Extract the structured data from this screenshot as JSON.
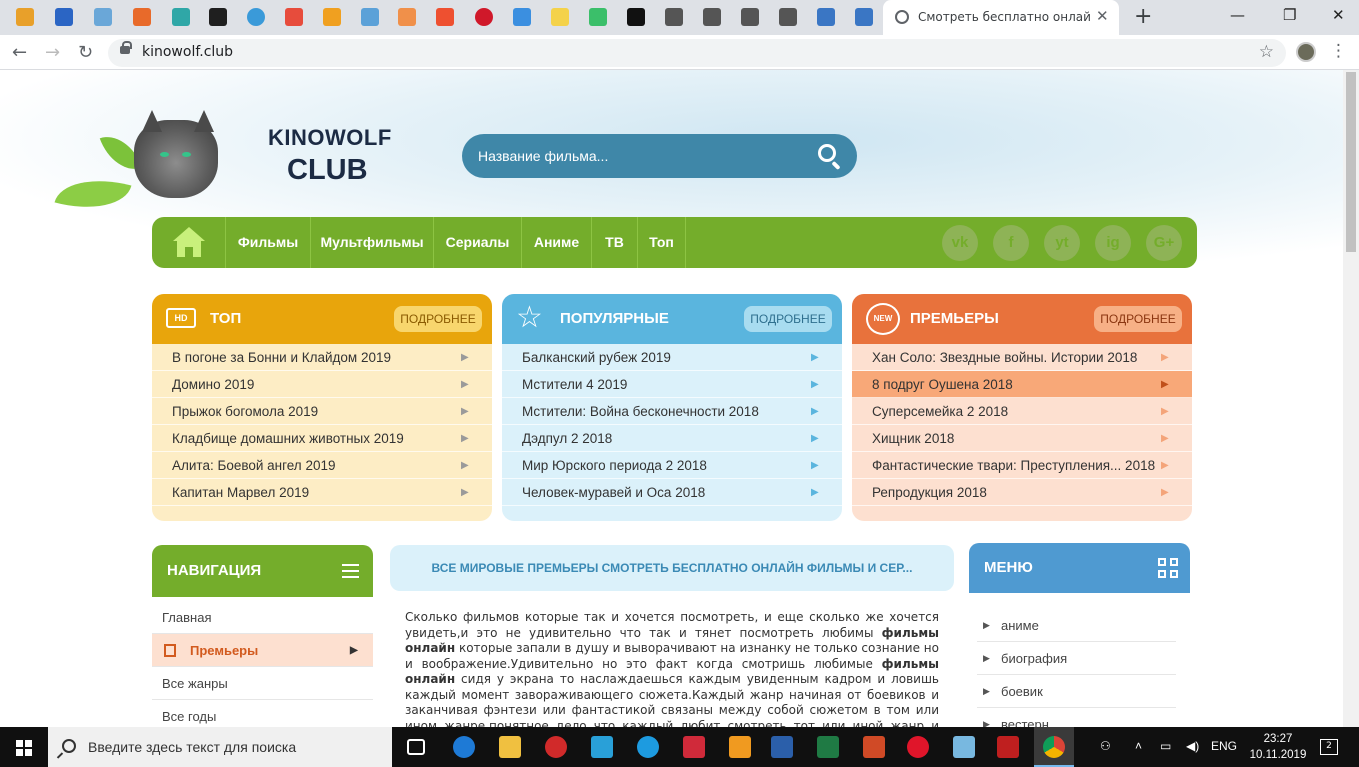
{
  "browser": {
    "active_tab_title": "Смотреть бесплатно онлайн фильмы",
    "url": "kinowolf.club",
    "tab_icons": [
      "gmail-icon",
      "mail-icon",
      "mailbox-icon",
      "bug-icon",
      "t-icon",
      "ap-icon",
      "target-icon",
      "chart-icon",
      "bars-icon",
      "photo-icon",
      "cloud-icon",
      "squiggle-icon",
      "m-icon",
      "d-icon",
      "note-icon",
      "play-icon",
      "k-icon",
      "avatar-icon",
      "avatar-icon",
      "avatar-icon",
      "avatar-icon",
      "database-icon",
      "database-icon"
    ]
  },
  "site": {
    "logo_line1": "KINOWOLF",
    "logo_line2": "CLUB",
    "search_placeholder": "Название фильма...",
    "nav": [
      "Фильмы",
      "Мультфильмы",
      "Сериалы",
      "Аниме",
      "ТВ",
      "Топ"
    ],
    "social": [
      "vk",
      "f",
      "yt",
      "ig",
      "G+"
    ],
    "more_label": "ПОДРОБНЕЕ",
    "top": {
      "title": "ТОП",
      "items": [
        "В погоне за Бонни и Клайдом 2019",
        "Домино 2019",
        "Прыжок богомола 2019",
        "Кладбище домашних животных 2019",
        "Алита: Боевой ангел 2019",
        "Капитан Марвел 2019"
      ]
    },
    "popular": {
      "title": "ПОПУЛЯРНЫЕ",
      "items": [
        "Балканский рубеж 2019",
        "Мстители 4 2019",
        "Мстители: Война бесконечности 2018",
        "Дэдпул 2 2018",
        "Мир Юрского периода 2 2018",
        "Человек-муравей и Оса 2018"
      ]
    },
    "premieres": {
      "title": "ПРЕМЬЕРЫ",
      "items": [
        "Хан Соло: Звездные войны. Истории 2018",
        "8 подруг Оушена 2018",
        "Суперсемейка 2 2018",
        "Хищник 2018",
        "Фантастические твари: Преступления... 2018",
        "Репродукция 2018"
      ]
    },
    "left_nav": {
      "title": "НАВИГАЦИЯ",
      "items": [
        "Главная",
        "Премьеры",
        "Все жанры",
        "Все годы"
      ]
    },
    "banner": "ВСЕ МИРОВЫЕ ПРЕМЬЕРЫ СМОТРЕТЬ БЕСПЛАТНО ОНЛАЙН ФИЛЬМЫ И СЕР...",
    "article": {
      "p1": "Сколько фильмов которые так и хочется посмотреть, и еще сколько же хочется увидеть,и это не удивительно что так и тянет посмотреть любимы ",
      "b1": "фильмы онлайн",
      "p2": " которые запали в душу и выворачивают на изнанку не только сознание но и воображение.Удивительно но это факт когда смотришь любимые ",
      "b2": "фильмы онлайн",
      "p3": " сидя у экрана то наслаждаешься каждым увиденным кадром и ловишь каждый момент завораживающего сюжета.Каждый жанр начиная от боевиков и заканчивая фэнтези или фантастикой связаны между собой сюжетом в том или ином жанре,понятное дело что каждый любит смотреть тот или иной жанр и сидеть часами у экрана"
    },
    "right_menu": {
      "title": "МЕНЮ",
      "items": [
        "аниме",
        "биография",
        "боевик",
        "вестерн"
      ]
    }
  },
  "taskbar": {
    "search_placeholder": "Введите здесь текст для поиска",
    "lang": "ENG",
    "time": "23:27",
    "date": "10.11.2019",
    "notifications": "2"
  }
}
